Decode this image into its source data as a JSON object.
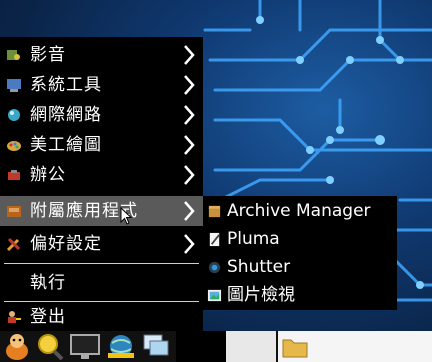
{
  "main_menu": {
    "items": [
      {
        "label": "影音",
        "icon": "multimedia-icon",
        "submenu": true
      },
      {
        "label": "系統工具",
        "icon": "system-tools-icon",
        "submenu": true
      },
      {
        "label": "網際網路",
        "icon": "internet-icon",
        "submenu": true
      },
      {
        "label": "美工繪圖",
        "icon": "graphics-icon",
        "submenu": true
      },
      {
        "label": "辦公",
        "icon": "office-icon",
        "submenu": true
      },
      {
        "label": "附屬應用程式",
        "icon": "accessories-icon",
        "submenu": true,
        "active": true
      },
      {
        "label": "偏好設定",
        "icon": "preferences-icon",
        "submenu": true
      },
      {
        "label": "執行",
        "icon": "",
        "submenu": false
      },
      {
        "label": "登出",
        "icon": "logout-icon",
        "submenu": false
      }
    ]
  },
  "submenu": {
    "items": [
      {
        "label": "Archive Manager",
        "icon": "archive-manager-icon"
      },
      {
        "label": "Pluma",
        "icon": "pluma-icon"
      },
      {
        "label": "Shutter",
        "icon": "shutter-icon"
      },
      {
        "label": "圖片檢視",
        "icon": "image-viewer-icon"
      }
    ]
  },
  "taskbar": {
    "icons": [
      "start-menu-icon",
      "search-icon",
      "monitor-icon",
      "network-globe-icon",
      "windows-icon",
      "folder-icon"
    ]
  },
  "colors": {
    "menu_bg": "#000000",
    "menu_active_bg": "#5a5a5a",
    "menu_text": "#ffffff",
    "desktop_bg": "#103a72",
    "circuit": "#3fa7ff"
  }
}
